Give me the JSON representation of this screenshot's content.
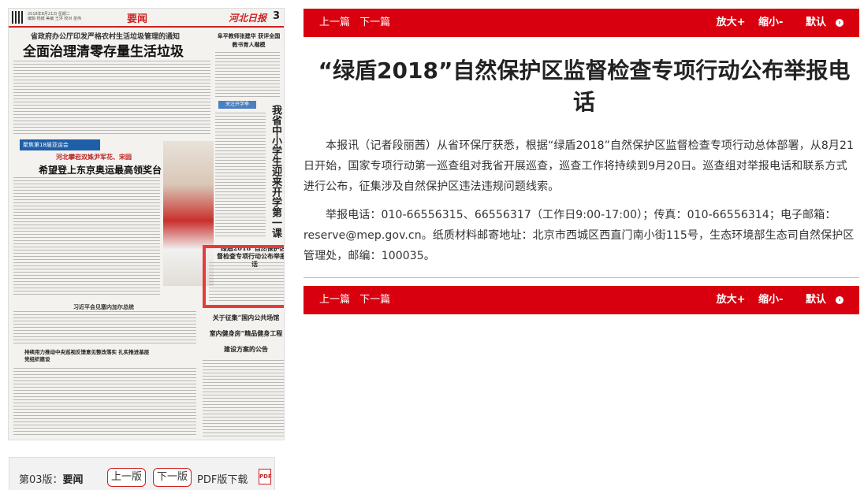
{
  "newspaper": {
    "meta_line_1": "2018年8月21日 星期二",
    "meta_line_2": "编辑 杨姆 美编 王洪 校对 苗伟",
    "section": "要闻",
    "logo": "河北日报",
    "page_number": "3",
    "kicker": "省政府办公厅印发严格农村生活垃圾管理的通知",
    "lead_headline": "全面治理清零存量生活垃圾",
    "side_headline": "阜平教师张建华 获评全国教书育人楷模",
    "tab": "关注开学季",
    "vertical_headline": "我省中小学生迎来开学第一课",
    "sport_band": "聚焦第18届亚运会",
    "sport_sub": "河北攀岩双姝尹军花、宋园",
    "sport_headline": "希望登上东京奥运最高领奖台",
    "highlight_title": "“绿盾2018”自然保护区监督检查专项行动公布举报电话",
    "mid_headline": "习近平会见塞内加尔总统",
    "notice_line_1": "关于征集“国内公共场馆",
    "notice_line_2": "室内健身房”精品健身工程",
    "notice_line_3": "建设方案的公告",
    "sub_headline": "持续用力推动中央巡视反馈意见整改落实 扎实推进基层党组织建设"
  },
  "page_nav": {
    "page_label": "第03版：",
    "page_name": "要闻",
    "prev_page": "上一版",
    "next_page": "下一版",
    "pdf_download": "PDF版下载",
    "pdf_icon": "PDF"
  },
  "article_nav": {
    "prev": "上一篇",
    "next": "下一篇",
    "zoom_in": "放大+",
    "zoom_out": "缩小-",
    "default": "默认",
    "default_icon": "circle-icon"
  },
  "article": {
    "title": "“绿盾2018”自然保护区监督检查专项行动公布举报电话",
    "paragraphs": [
      "本报讯（记者段丽茜）从省环保厅获悉，根据“绿盾2018”自然保护区监督检查专项行动总体部署，从8月21日开始，国家专项行动第一巡查组对我省开展巡查，巡查工作将持续到9月20日。巡查组对举报电话和联系方式进行公布，征集涉及自然保护区违法违规问题线索。",
      "举报电话：010-66556315、66556317（工作日9:00-17:00）；传真：010-66556314；电子邮箱：reserve@mep.gov.cn。纸质材料邮寄地址：北京市西城区西直门南小街115号，生态环境部生态司自然保护区管理处，邮编：100035。"
    ]
  },
  "colors": {
    "accent_red": "#d8000f",
    "highlight_red": "#e83a3a"
  }
}
